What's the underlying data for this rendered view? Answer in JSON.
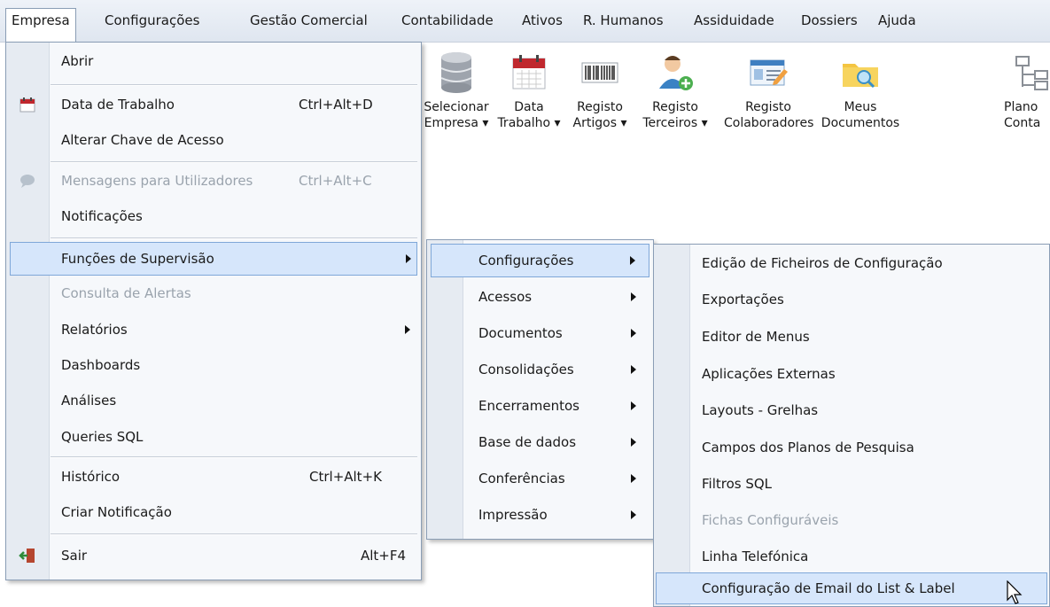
{
  "menubar": [
    {
      "label": "Empresa"
    },
    {
      "label": "Configurações"
    },
    {
      "label": "Gestão Comercial"
    },
    {
      "label": "Contabilidade"
    },
    {
      "label": "Ativos"
    },
    {
      "label": "R. Humanos"
    },
    {
      "label": "Assiduidade"
    },
    {
      "label": "Dossiers"
    },
    {
      "label": "Ajuda"
    }
  ],
  "ribbon": [
    {
      "line1": "Selecionar",
      "line2": "Empresa ▾",
      "icon": "database-icon"
    },
    {
      "line1": "Data",
      "line2": "Trabalho ▾",
      "icon": "calendar-icon"
    },
    {
      "line1": "Registo",
      "line2": "Artigos ▾",
      "icon": "barcode-icon"
    },
    {
      "line1": "Registo",
      "line2": "Terceiros ▾",
      "icon": "person-add-icon"
    },
    {
      "line1": "Registo",
      "line2": "Colaboradores",
      "icon": "id-card-icon"
    },
    {
      "line1": "Meus",
      "line2": "Documentos",
      "icon": "folder-search-icon"
    },
    {
      "line1": "Plano",
      "line2": "Conta",
      "icon": "chart-of-accounts-icon"
    }
  ],
  "empresa_menu": {
    "items": [
      {
        "label": "Abrir",
        "shortcut": ""
      },
      {
        "label": "Data de Trabalho",
        "shortcut": "Ctrl+Alt+D"
      },
      {
        "label": "Alterar Chave de Acesso",
        "shortcut": ""
      },
      {
        "label": "Mensagens para Utilizadores",
        "shortcut": "Ctrl+Alt+C"
      },
      {
        "label": "Notificações",
        "shortcut": ""
      },
      {
        "label": "Funções de Supervisão",
        "shortcut": ""
      },
      {
        "label": "Consulta de Alertas",
        "shortcut": ""
      },
      {
        "label": "Relatórios",
        "shortcut": ""
      },
      {
        "label": "Dashboards",
        "shortcut": ""
      },
      {
        "label": "Análises",
        "shortcut": ""
      },
      {
        "label": "Queries SQL",
        "shortcut": ""
      },
      {
        "label": "Histórico",
        "shortcut": "Ctrl+Alt+K"
      },
      {
        "label": "Criar Notificação",
        "shortcut": ""
      },
      {
        "label": "Sair",
        "shortcut": "Alt+F4"
      }
    ]
  },
  "supervisao_menu": {
    "items": [
      {
        "label": "Configurações"
      },
      {
        "label": "Acessos"
      },
      {
        "label": "Documentos"
      },
      {
        "label": "Consolidações"
      },
      {
        "label": "Encerramentos"
      },
      {
        "label": "Base de dados"
      },
      {
        "label": "Conferências"
      },
      {
        "label": "Impressão"
      }
    ]
  },
  "config_menu": {
    "items": [
      {
        "label": "Edição de Ficheiros de Configuração"
      },
      {
        "label": "Exportações"
      },
      {
        "label": "Editor de Menus"
      },
      {
        "label": "Aplicações Externas"
      },
      {
        "label": "Layouts - Grelhas"
      },
      {
        "label": "Campos dos Planos de Pesquisa"
      },
      {
        "label": "Filtros SQL"
      },
      {
        "label": "Fichas Configuráveis"
      },
      {
        "label": "Linha Telefónica"
      },
      {
        "label": "Configuração de Email do List & Label"
      }
    ]
  },
  "colors": {
    "highlight": "#d6e6fb",
    "highlight_border": "#7fa7d8",
    "disabled": "#9aa3ad"
  }
}
